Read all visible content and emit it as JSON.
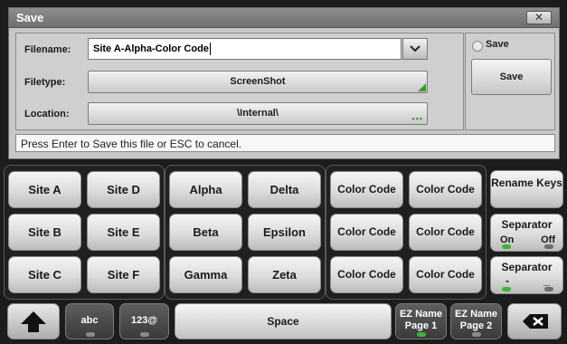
{
  "dialog": {
    "title": "Save",
    "close_icon": "close-x-icon",
    "filename_label": "Filename:",
    "filename_value": "Site A-Alpha-Color Code",
    "filetype_label": "Filetype:",
    "filetype_value": "ScreenShot",
    "location_label": "Location:",
    "location_value": "\\Internal\\",
    "save_checkbox_label": "Save",
    "save_button": "Save",
    "status": "Press Enter to Save this file or ESC to cancel."
  },
  "keyboard": {
    "sites": [
      "Site A",
      "Site D",
      "Site B",
      "Site E",
      "Site C",
      "Site F"
    ],
    "greek": [
      "Alpha",
      "Delta",
      "Beta",
      "Epsilon",
      "Gamma",
      "Zeta"
    ],
    "codes": [
      "Color Code",
      "Color Code",
      "Color Code",
      "Color Code",
      "Color Code",
      "Color Code"
    ],
    "rename_keys": "Rename Keys",
    "separator1": {
      "title": "Separator",
      "on": "On",
      "off": "Off"
    },
    "separator2": {
      "title": "Separator",
      "left": "-",
      "right": "_"
    },
    "shift_icon": "shift-up-arrow-icon",
    "abc": "abc",
    "num": "123@",
    "space": "Space",
    "ez1": "EZ Name Page 1",
    "ez2": "EZ Name Page 2",
    "backspace_icon": "backspace-icon",
    "accent_green": "#3fb33a"
  }
}
